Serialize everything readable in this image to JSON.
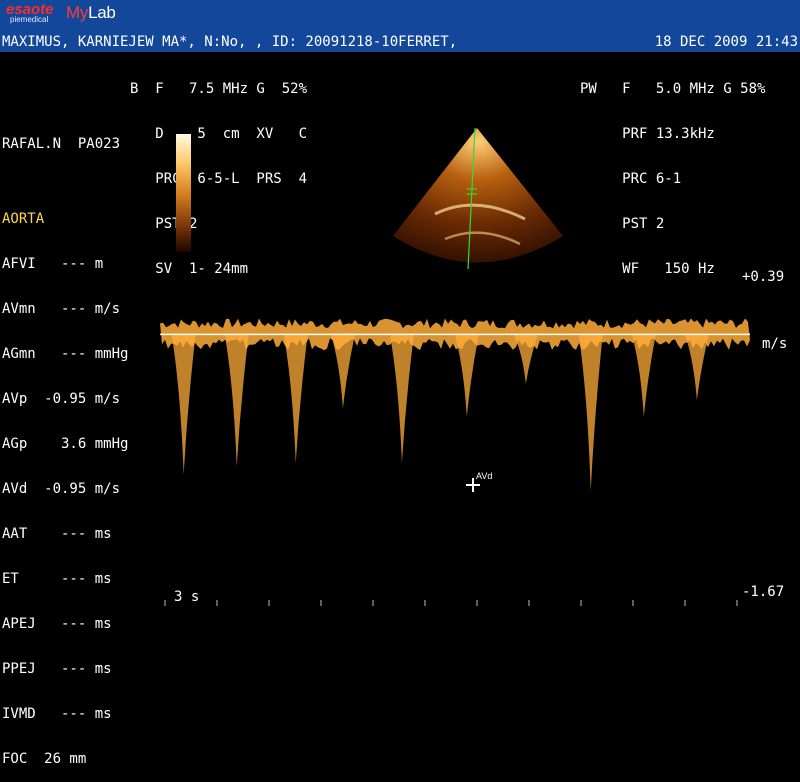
{
  "header": {
    "brand_esaote": "esaote",
    "brand_sub": "piemedical",
    "brand_mylab_a": "My",
    "brand_mylab_b": "Lab",
    "patient_line": "MAXIMUS, KARNIEJEW MA*, N:No, , ID: 20091218-10FERRET,",
    "datetime": "18 DEC 2009 21:43"
  },
  "b_mode": {
    "lines": [
      "B  F   7.5 MHz G  52%",
      "   D    5  cm  XV   C",
      "   PRC  6-5-L  PRS  4",
      "   PST 2",
      "   SV  1- 24mm"
    ]
  },
  "pw_mode": {
    "lines": [
      "PW   F   5.0 MHz G 58%",
      "     PRF 13.3kHz",
      "     PRC 6-1",
      "     PST 2",
      "     WF   150 Hz"
    ]
  },
  "operator": "RAFAL.N  PA023",
  "measurements": {
    "title": "AORTA",
    "rows": [
      "AFVI   --- m",
      "AVmn   --- m/s",
      "AGmn   --- mmHg",
      "AVp  -0.95 m/s",
      "AGp    3.6 mmHg",
      "AVd  -0.95 m/s",
      "AAT    --- ms",
      "ET     --- ms",
      "APEJ   --- ms",
      "PPEJ   --- ms",
      "IVMD   --- ms",
      "FOC  26 mm"
    ]
  },
  "scale": {
    "top": "+0.39",
    "unit": "m/s",
    "bottom": "-1.67",
    "vmax": 0.39,
    "vmin": -1.67
  },
  "sweep": "3 s",
  "cursor_label": "AVd",
  "colors": {
    "header_bg": "#12479a",
    "title_yellow": "#ffd84a",
    "doppler": "#ffae3a"
  },
  "waveform": {
    "peaks_x_fraction": [
      0.04,
      0.13,
      0.23,
      0.31,
      0.41,
      0.52,
      0.62,
      0.73,
      0.82,
      0.91
    ],
    "peaks_velocity": [
      -0.85,
      -0.8,
      -0.78,
      -0.45,
      -0.78,
      -0.5,
      -0.3,
      -0.95,
      -0.5,
      -0.4
    ]
  }
}
